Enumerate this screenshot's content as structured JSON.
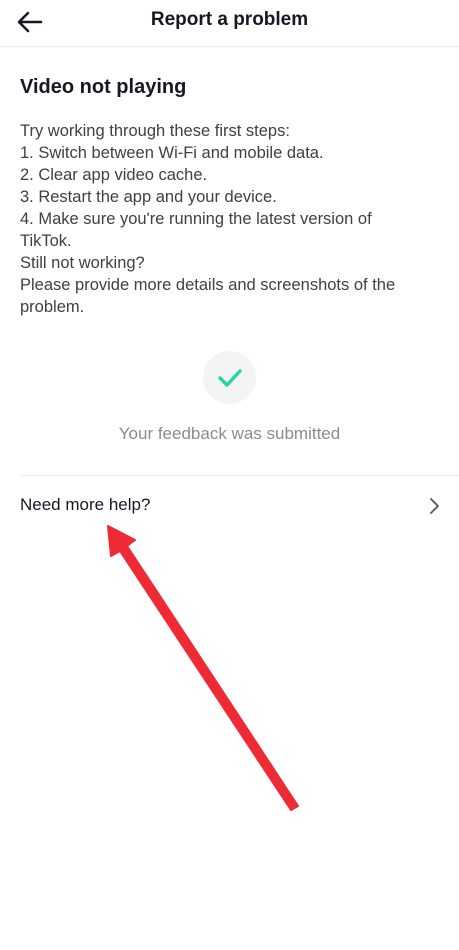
{
  "header": {
    "title": "Report a problem",
    "back_icon": "arrow-left-icon"
  },
  "content": {
    "title": "Video not playing",
    "steps": [
      "Try working through these first steps:",
      "1. Switch between Wi-Fi and mobile data.",
      "2. Clear app video cache.",
      "3. Restart the app and your device.",
      "4. Make sure you're running the latest version of",
      "TikTok.",
      "Still not working?",
      "Please provide more details and screenshots of the",
      "problem."
    ]
  },
  "status": {
    "icon": "check-icon",
    "accent_color": "#20d5a0",
    "message": "Your feedback was submitted"
  },
  "help": {
    "label": "Need more help?",
    "icon": "chevron-right-icon"
  },
  "annotation": {
    "icon": "red-arrow-icon",
    "color": "#ee2b35"
  }
}
